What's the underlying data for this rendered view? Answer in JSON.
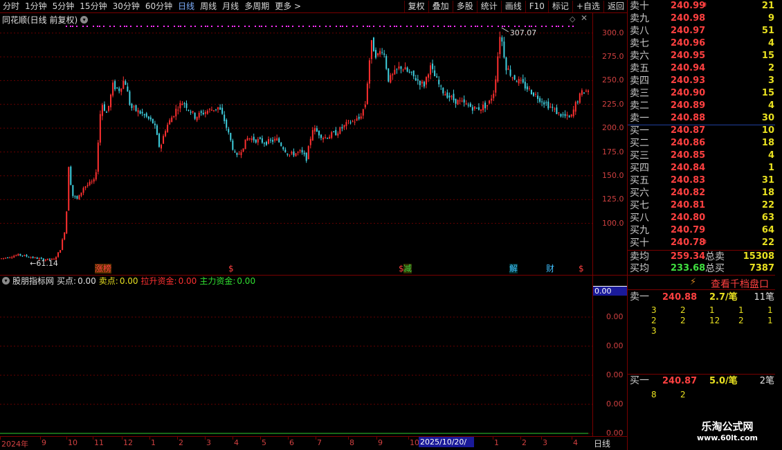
{
  "toolbar": {
    "left": [
      "分时",
      "1分钟",
      "5分钟",
      "15分钟",
      "30分钟",
      "60分钟",
      "日线",
      "周线",
      "月线",
      "多周期",
      "更多 >"
    ],
    "active": "日线",
    "right": [
      "复权",
      "叠加",
      "多股",
      "统计",
      "画线",
      "F10",
      "标记",
      "+自选",
      "返回"
    ]
  },
  "chart": {
    "title": "同花顺(日线 前复权)",
    "high_label": "307.07",
    "low_label": "←61.14",
    "y_ticks": [
      "300.0",
      "275.0",
      "250.0",
      "225.0",
      "200.0",
      "175.0",
      "150.0",
      "125.0",
      "100.0"
    ],
    "markers": [
      {
        "text": "涨榜",
        "color": "#ff4040",
        "bg": "#5a3000"
      },
      {
        "text": "$",
        "color": "#ff4040",
        "bg": ""
      },
      {
        "text": "$",
        "color": "#ff4040",
        "bg": ""
      },
      {
        "text": "减",
        "color": "#40d040",
        "bg": "#303000"
      },
      {
        "text": "解",
        "color": "#40c0ff",
        "bg": "#003030"
      },
      {
        "text": "财",
        "color": "#40c0ff",
        "bg": ""
      },
      {
        "text": "$",
        "color": "#ff4040",
        "bg": ""
      }
    ]
  },
  "indicator": {
    "name": "股朋指标网",
    "buy_label": "买点:",
    "buy_value": "0.00",
    "sell_label": "卖点:",
    "sell_value": "0.00",
    "pull_label": "拉升资金:",
    "pull_value": "0.00",
    "main_label": "主力资金:",
    "main_value": "0.00",
    "current_value": "0.00",
    "y_ticks": [
      "0.00",
      "0.00",
      "0.00",
      "0.00",
      "0.00"
    ]
  },
  "date_axis": {
    "labels": [
      "2024年",
      "9",
      "10",
      "11",
      "12",
      "1",
      "2",
      "3",
      "4",
      "5",
      "6",
      "7",
      "8",
      "9",
      "10"
    ],
    "cursor": "2025/10/20/一",
    "labels_after": [
      "1",
      "2",
      "3",
      "4"
    ],
    "period": "日线"
  },
  "order_book": {
    "sell": [
      {
        "name": "卖十",
        "price": "240.99",
        "vol": "21"
      },
      {
        "name": "卖九",
        "price": "240.98",
        "vol": "9"
      },
      {
        "name": "卖八",
        "price": "240.97",
        "vol": "51"
      },
      {
        "name": "卖七",
        "price": "240.96",
        "vol": "4"
      },
      {
        "name": "卖六",
        "price": "240.95",
        "vol": "15"
      },
      {
        "name": "卖五",
        "price": "240.94",
        "vol": "2"
      },
      {
        "name": "卖四",
        "price": "240.93",
        "vol": "3"
      },
      {
        "name": "卖三",
        "price": "240.90",
        "vol": "15"
      },
      {
        "name": "卖二",
        "price": "240.89",
        "vol": "4"
      },
      {
        "name": "卖一",
        "price": "240.88",
        "vol": "30"
      }
    ],
    "buy": [
      {
        "name": "买一",
        "price": "240.87",
        "vol": "10"
      },
      {
        "name": "买二",
        "price": "240.86",
        "vol": "18"
      },
      {
        "name": "买三",
        "price": "240.85",
        "vol": "4"
      },
      {
        "name": "买四",
        "price": "240.84",
        "vol": "1"
      },
      {
        "name": "买五",
        "price": "240.83",
        "vol": "31"
      },
      {
        "name": "买六",
        "price": "240.82",
        "vol": "18"
      },
      {
        "name": "买七",
        "price": "240.81",
        "vol": "22"
      },
      {
        "name": "买八",
        "price": "240.80",
        "vol": "63"
      },
      {
        "name": "买九",
        "price": "240.79",
        "vol": "64"
      },
      {
        "name": "买十",
        "price": "240.78",
        "vol": "22"
      }
    ],
    "avg_sell_label": "卖均",
    "avg_sell": "259.34",
    "total_sell_label": "总卖",
    "total_sell": "15308",
    "avg_buy_label": "买均",
    "avg_buy": "233.68",
    "total_buy_label": "总买",
    "total_buy": "7387",
    "view_button": "查看千档盘口",
    "queue_sell": {
      "name": "卖一",
      "price": "240.88",
      "per": "2.7/笔",
      "count": "11笔",
      "nums": [
        "3",
        "2",
        "1",
        "1",
        "1",
        "2",
        "2",
        "12",
        "2",
        "1",
        "3"
      ]
    },
    "queue_buy": {
      "name": "买一",
      "price": "240.87",
      "per": "5.0/笔",
      "count": "2笔",
      "nums": [
        "8",
        "2"
      ]
    }
  },
  "watermark": {
    "line1": "乐淘公式网",
    "line2": "www.60lt.com"
  },
  "colors": {
    "up": "#ff3030",
    "down": "#40d0e0",
    "magenta": "#ff30ff",
    "frame": "#7a0000"
  },
  "chart_data": {
    "type": "candlestick",
    "ylim": [
      61.14,
      307.07
    ],
    "y_ticks": [
      100,
      125,
      150,
      175,
      200,
      225,
      250,
      275,
      300
    ],
    "keypoints": [
      [
        0,
        63
      ],
      [
        0.03,
        67
      ],
      [
        0.07,
        62
      ],
      [
        0.09,
        62
      ],
      [
        0.1,
        72
      ],
      [
        0.11,
        98
      ],
      [
        0.115,
        165
      ],
      [
        0.12,
        130
      ],
      [
        0.13,
        125
      ],
      [
        0.14,
        138
      ],
      [
        0.16,
        145
      ],
      [
        0.17,
        228
      ],
      [
        0.18,
        215
      ],
      [
        0.19,
        245
      ],
      [
        0.2,
        240
      ],
      [
        0.21,
        252
      ],
      [
        0.22,
        222
      ],
      [
        0.24,
        215
      ],
      [
        0.26,
        205
      ],
      [
        0.27,
        178
      ],
      [
        0.28,
        200
      ],
      [
        0.3,
        222
      ],
      [
        0.31,
        228
      ],
      [
        0.33,
        212
      ],
      [
        0.35,
        218
      ],
      [
        0.37,
        222
      ],
      [
        0.38,
        208
      ],
      [
        0.4,
        168
      ],
      [
        0.42,
        190
      ],
      [
        0.45,
        185
      ],
      [
        0.47,
        188
      ],
      [
        0.49,
        172
      ],
      [
        0.51,
        175
      ],
      [
        0.52,
        168
      ],
      [
        0.53,
        200
      ],
      [
        0.55,
        190
      ],
      [
        0.57,
        195
      ],
      [
        0.59,
        205
      ],
      [
        0.61,
        210
      ],
      [
        0.62,
        225
      ],
      [
        0.63,
        290
      ],
      [
        0.64,
        275
      ],
      [
        0.65,
        285
      ],
      [
        0.66,
        250
      ],
      [
        0.68,
        265
      ],
      [
        0.7,
        255
      ],
      [
        0.72,
        245
      ],
      [
        0.73,
        265
      ],
      [
        0.75,
        240
      ],
      [
        0.77,
        230
      ],
      [
        0.79,
        225
      ],
      [
        0.81,
        220
      ],
      [
        0.83,
        225
      ],
      [
        0.84,
        240
      ],
      [
        0.85,
        302
      ],
      [
        0.86,
        265
      ],
      [
        0.87,
        255
      ],
      [
        0.89,
        245
      ],
      [
        0.91,
        235
      ],
      [
        0.93,
        225
      ],
      [
        0.95,
        215
      ],
      [
        0.97,
        210
      ],
      [
        0.98,
        228
      ],
      [
        0.99,
        238
      ],
      [
        1,
        240
      ]
    ]
  }
}
